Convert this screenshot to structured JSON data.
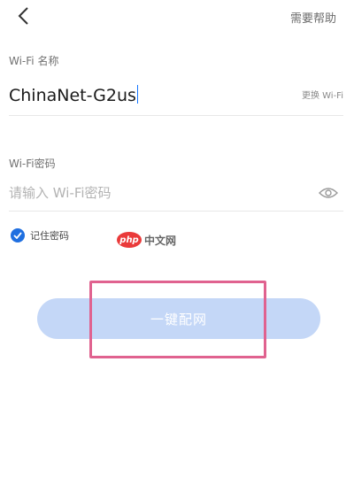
{
  "header": {
    "back_icon": "chevron-left-icon",
    "help_label": "需要帮助"
  },
  "ssid": {
    "label": "Wi-Fi 名称",
    "value": "ChinaNet-G2us",
    "switch_label": "更换 Wi-Fi"
  },
  "password": {
    "label": "Wi-Fi密码",
    "placeholder": "请输入 Wi-Fi密码",
    "value": "",
    "visibility_icon": "eye-icon"
  },
  "remember": {
    "label": "记住密码",
    "checked": true
  },
  "watermark": {
    "logo_text": "php",
    "text": "中文网"
  },
  "primary_button": {
    "label": "一键配网"
  },
  "colors": {
    "accent": "#1f6fe0",
    "button_disabled_bg": "#c4d7f7",
    "highlight_border": "#e0628f"
  }
}
